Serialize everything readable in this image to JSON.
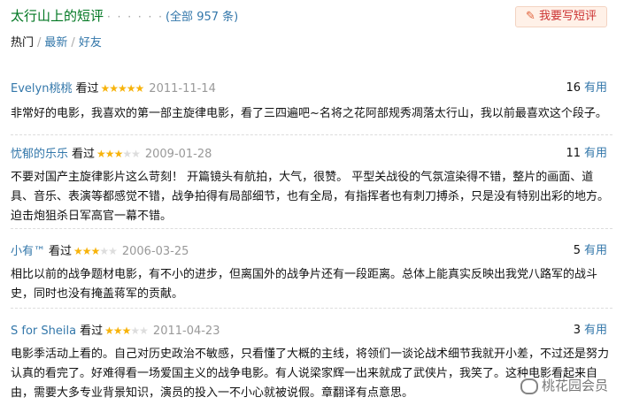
{
  "header": {
    "title": "太行山上的短评",
    "dots": "· · · · · ·",
    "total": "(全部 957 条)",
    "write_button": "我要写短评"
  },
  "tabs": [
    {
      "label": "热门"
    },
    {
      "label": "最新"
    },
    {
      "label": "好友"
    }
  ],
  "reviews": [
    {
      "user": "Evelyn桃桃",
      "status": "看过",
      "rating": 5,
      "date": "2011-11-14",
      "useful_count": "16",
      "useful_label": "有用",
      "content": "非常好的电影，我喜欢的第一部主旋律电影，看了三四遍吧~名将之花阿部规秀凋落太行山，我以前最喜欢这个段子。"
    },
    {
      "user": "忧郁的乐乐",
      "status": "看过",
      "rating": 3,
      "date": "2009-01-28",
      "useful_count": "11",
      "useful_label": "有用",
      "content": "不要对国产主旋律影片这么苛刻！ 开篇镜头有航拍，大气，很赞。 平型关战役的气氛渲染得不错，整片的画面、道具、音乐、表演等都感觉不错，战争拍得有局部细节，也有全局，有指挥者也有刺刀搏杀，只是没有特别出彩的地方。 迫击炮狙杀日军高官一幕不错。"
    },
    {
      "user": "小有™",
      "status": "看过",
      "rating": 3,
      "date": "2006-03-25",
      "useful_count": "5",
      "useful_label": "有用",
      "content": "相比以前的战争题材电影，有不小的进步，但离国外的战争片还有一段距离。总体上能真实反映出我党八路军的战斗史，同时也没有掩盖蒋军的贡献。"
    },
    {
      "user": "S for Sheila",
      "status": "看过",
      "rating": 3,
      "date": "2011-04-23",
      "useful_count": "3",
      "useful_label": "有用",
      "content": "电影季活动上看的。自己对历史政治不敏感，只看懂了大概的主线，将领们一谈论战术细节我就开小差，不过还是努力认真的看完了。好难得看一场爱国主义的战争电影。有人说梁家辉一出来就成了武侠片，我笑了。这种电影看起来自由，需要大多专业背景知识，演员的投入一不小心就被说假。章翻译有点意思。"
    }
  ],
  "watermark": "桃花园会员"
}
